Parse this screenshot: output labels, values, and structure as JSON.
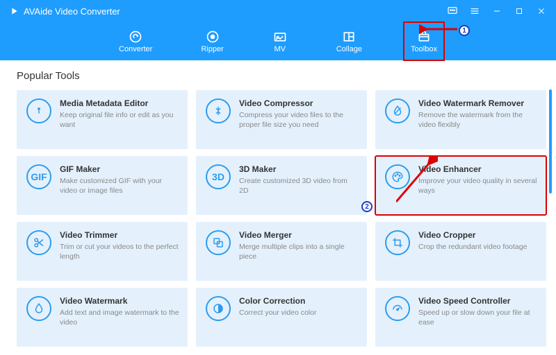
{
  "app": {
    "title": "AVAide Video Converter"
  },
  "nav": {
    "items": [
      {
        "label": "Converter"
      },
      {
        "label": "Ripper"
      },
      {
        "label": "MV"
      },
      {
        "label": "Collage"
      },
      {
        "label": "Toolbox"
      }
    ],
    "activeIndex": 4
  },
  "section": {
    "title": "Popular Tools"
  },
  "tools": [
    {
      "title": "Media Metadata Editor",
      "desc": "Keep original file info or edit as you want",
      "icon": "info"
    },
    {
      "title": "Video Compressor",
      "desc": "Compress your video files to the proper file size you need",
      "icon": "compress"
    },
    {
      "title": "Video Watermark Remover",
      "desc": "Remove the watermark from the video flexibly",
      "icon": "wm-remove"
    },
    {
      "title": "GIF Maker",
      "desc": "Make customized GIF with your video or image files",
      "icon": "gif"
    },
    {
      "title": "3D Maker",
      "desc": "Create customized 3D video from 2D",
      "icon": "3d"
    },
    {
      "title": "Video Enhancer",
      "desc": "Improve your video quality in several ways",
      "icon": "palette",
      "highlight": true
    },
    {
      "title": "Video Trimmer",
      "desc": "Trim or cut your videos to the perfect length",
      "icon": "scissors"
    },
    {
      "title": "Video Merger",
      "desc": "Merge multiple clips into a single piece",
      "icon": "merge"
    },
    {
      "title": "Video Cropper",
      "desc": "Crop the redundant video footage",
      "icon": "crop"
    },
    {
      "title": "Video Watermark",
      "desc": "Add text and image watermark to the video",
      "icon": "drop"
    },
    {
      "title": "Color Correction",
      "desc": "Correct your video color",
      "icon": "color"
    },
    {
      "title": "Video Speed Controller",
      "desc": "Speed up or slow down your file at ease",
      "icon": "speed"
    }
  ],
  "annotations": {
    "step1": "1",
    "step2": "2"
  }
}
